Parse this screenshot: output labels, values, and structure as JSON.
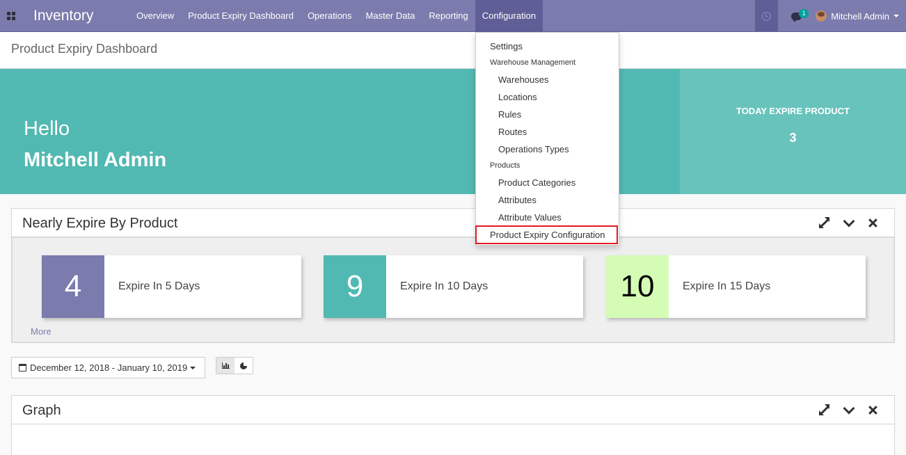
{
  "navbar": {
    "app_title": "Inventory",
    "menu": [
      "Overview",
      "Product Expiry Dashboard",
      "Operations",
      "Master Data",
      "Reporting",
      "Configuration"
    ],
    "active_menu": "Configuration",
    "chat_badge": "1",
    "user_name": "Mitchell Admin",
    "accent_color": "#7c7bad"
  },
  "breadcrumb": "Product Expiry Dashboard",
  "hero": {
    "greeting": "Hello",
    "name": "Mitchell Admin",
    "today_label": "TODAY EXPIRE PRODUCT",
    "today_value": "3"
  },
  "nearly_expire": {
    "title": "Nearly Expire By Product",
    "cards": [
      {
        "value": "4",
        "label": "Expire In 5 Days",
        "color": "#7c7bad"
      },
      {
        "value": "9",
        "label": "Expire In 10 Days",
        "color": "#52b9b2"
      },
      {
        "value": "10",
        "label": "Expire In 15 Days",
        "color": "#d4fcb5"
      }
    ],
    "more": "More"
  },
  "date_range": "December 12, 2018 - January 10, 2019",
  "graph": {
    "title": "Graph"
  },
  "config_dropdown": {
    "items": [
      {
        "type": "item",
        "label": "Settings"
      },
      {
        "type": "header",
        "label": "Warehouse Management"
      },
      {
        "type": "subitem",
        "label": "Warehouses"
      },
      {
        "type": "subitem",
        "label": "Locations"
      },
      {
        "type": "subitem",
        "label": "Rules"
      },
      {
        "type": "subitem",
        "label": "Routes"
      },
      {
        "type": "subitem",
        "label": "Operations Types"
      },
      {
        "type": "header",
        "label": "Products"
      },
      {
        "type": "subitem",
        "label": "Product Categories"
      },
      {
        "type": "subitem",
        "label": "Attributes"
      },
      {
        "type": "subitem",
        "label": "Attribute Values"
      },
      {
        "type": "item",
        "label": "Product Expiry Configuration"
      }
    ],
    "highlighted": "Product Expiry Configuration"
  }
}
